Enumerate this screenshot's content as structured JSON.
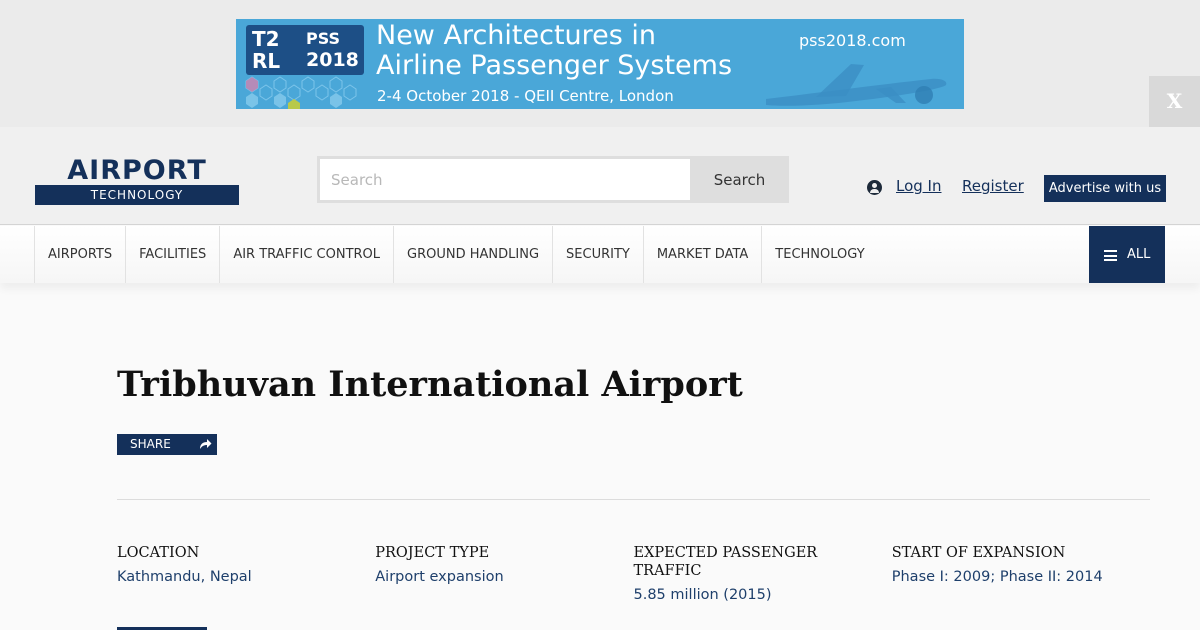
{
  "ad": {
    "logo_t2": "T2",
    "logo_rl": "RL",
    "logo_pss": "PSS",
    "logo_year": "2018",
    "headline_line1": "New Architectures in",
    "headline_line2": "Airline Passenger Systems",
    "subline": "2-4 October 2018 - QEII Centre, London",
    "url": "pss2018.com",
    "close_label": "X",
    "colors": {
      "background": "#4aa7d8",
      "logo_box": "#1d4f86"
    }
  },
  "header": {
    "logo_word": "AIRPORT",
    "logo_sub": "TECHNOLOGY",
    "search_placeholder": "Search",
    "search_button": "Search",
    "login": "Log In",
    "register": "Register",
    "advertise": "Advertise with us",
    "colors": {
      "brand": "#14305a"
    }
  },
  "nav": {
    "items": [
      "AIRPORTS",
      "FACILITIES",
      "AIR TRAFFIC CONTROL",
      "GROUND HANDLING",
      "SECURITY",
      "MARKET DATA",
      "TECHNOLOGY"
    ],
    "all_label": "ALL"
  },
  "page": {
    "title": "Tribhuvan International Airport",
    "share_label": "SHARE",
    "facts": [
      {
        "label": "LOCATION",
        "value": "Kathmandu, Nepal"
      },
      {
        "label": "PROJECT TYPE",
        "value": "Airport expansion"
      },
      {
        "label": "EXPECTED PASSENGER TRAFFIC",
        "value": "5.85 million (2015)"
      },
      {
        "label": "START OF EXPANSION",
        "value": "Phase I: 2009; Phase II: 2014"
      }
    ]
  }
}
